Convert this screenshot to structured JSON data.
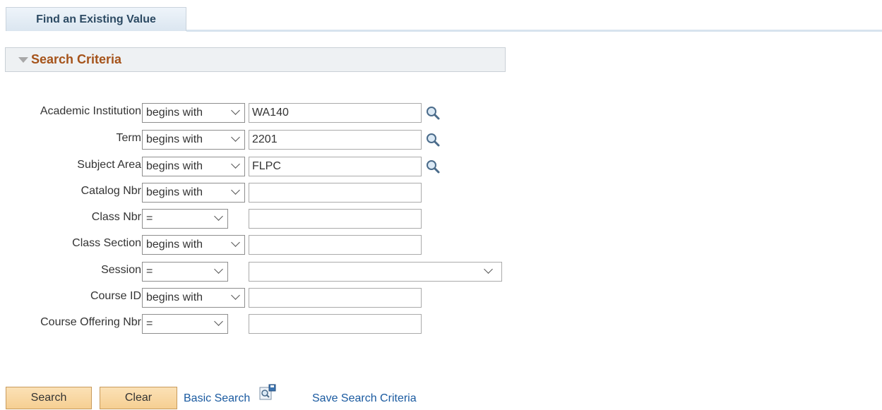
{
  "tab": {
    "label": "Find an Existing Value"
  },
  "criteria": {
    "title": "Search Criteria"
  },
  "fields": [
    {
      "label": "Academic Institution",
      "operator": "begins with",
      "value": "WA140"
    },
    {
      "label": "Term",
      "operator": "begins with",
      "value": "2201"
    },
    {
      "label": "Subject Area",
      "operator": "begins with",
      "value": "FLPC"
    },
    {
      "label": "Catalog Nbr",
      "operator": "begins with",
      "value": ""
    },
    {
      "label": "Class Nbr",
      "operator": "=",
      "value": ""
    },
    {
      "label": "Class Section",
      "operator": "begins with",
      "value": ""
    },
    {
      "label": "Session",
      "operator": "=",
      "value": ""
    },
    {
      "label": "Course ID",
      "operator": "begins with",
      "value": ""
    },
    {
      "label": "Course Offering Nbr",
      "operator": "=",
      "value": ""
    }
  ],
  "actions": {
    "search": "Search",
    "clear": "Clear",
    "basic_search": "Basic Search",
    "save_search": "Save Search Criteria"
  },
  "icons": {
    "lookup": "magnifier-icon",
    "save": "save-search-icon"
  },
  "colors": {
    "section_title": "#a5531a",
    "link": "#1a5aa0",
    "button": "#f6cf92"
  }
}
